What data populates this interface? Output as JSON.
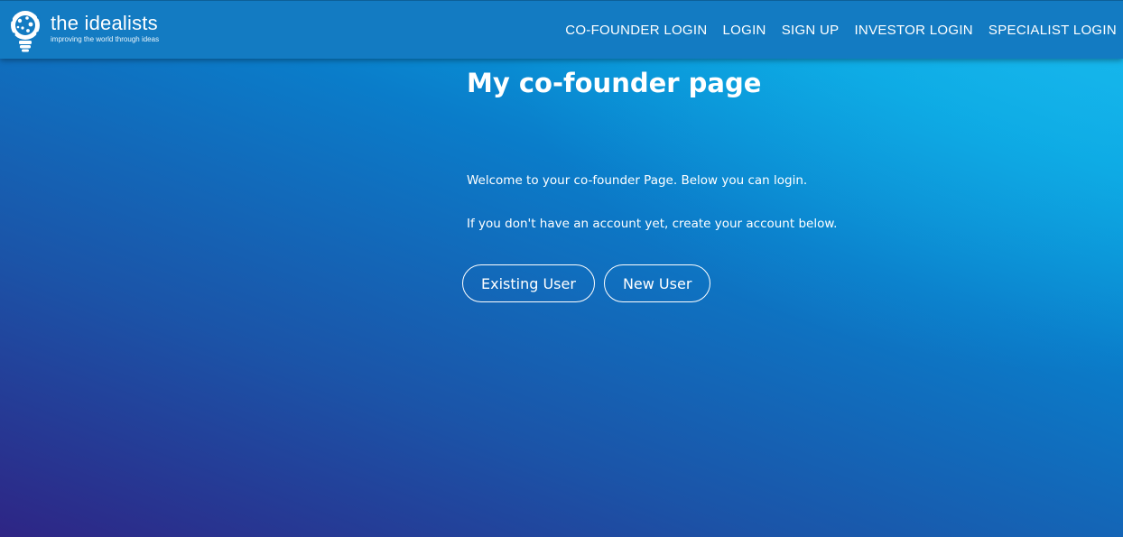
{
  "header": {
    "logo": {
      "title": "the idealists",
      "tagline": "improving the world through ideas",
      "icon": "lightbulb-icon"
    },
    "nav": [
      {
        "label": "CO-FOUNDER LOGIN"
      },
      {
        "label": "LOGIN"
      },
      {
        "label": "SIGN UP"
      },
      {
        "label": "INVESTOR LOGIN"
      },
      {
        "label": "SPECIALIST LOGIN"
      }
    ]
  },
  "main": {
    "title": "My co-founder page",
    "welcome_text": "Welcome to your co-founder Page. Below you can login.",
    "signup_hint": "If you don't have an account yet, create your account below.",
    "buttons": {
      "existing_user": "Existing User",
      "new_user": "New User"
    }
  },
  "colors": {
    "header_bg": "#137bc2",
    "gradient_dark": "#2e2585",
    "gradient_light": "#12b5ec",
    "text": "#ffffff"
  }
}
